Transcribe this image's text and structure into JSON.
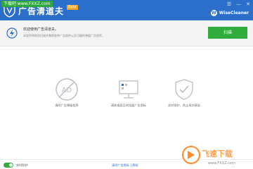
{
  "watermark_top": "下载吧 www.FXXZ.com",
  "titlebar": {
    "app_name": "广告清道夫",
    "badge": "Beta",
    "window_controls": [
      "☰",
      "—",
      "✕"
    ],
    "brand_name": "WiseCleaner"
  },
  "banner": {
    "title": "欢迎使用广告清道夫。",
    "description": "本程序将帮您扫描并删除各种广告插件以及可疑的弹窗广告程序。",
    "scan_label": "扫描"
  },
  "features": [
    {
      "icon": "no-ads-icon",
      "label": "清除广告弹窗程序"
    },
    {
      "icon": "monitor-icon",
      "label": "清除桌面及浏览器广告图标"
    },
    {
      "icon": "shield-check-icon",
      "label": "实时保护，防止再次感染"
    }
  ],
  "footer": {
    "protect_label": "实时防护",
    "links": [
      "清除广告图标",
      "帮助"
    ]
  },
  "site_watermark": {
    "brand": "飞速下载",
    "url": "www.FXXZ.com"
  },
  "colors": {
    "titlebar": "#2b6fcb",
    "scan_button": "#2fac3c",
    "toggle_on": "#2fac3c"
  }
}
